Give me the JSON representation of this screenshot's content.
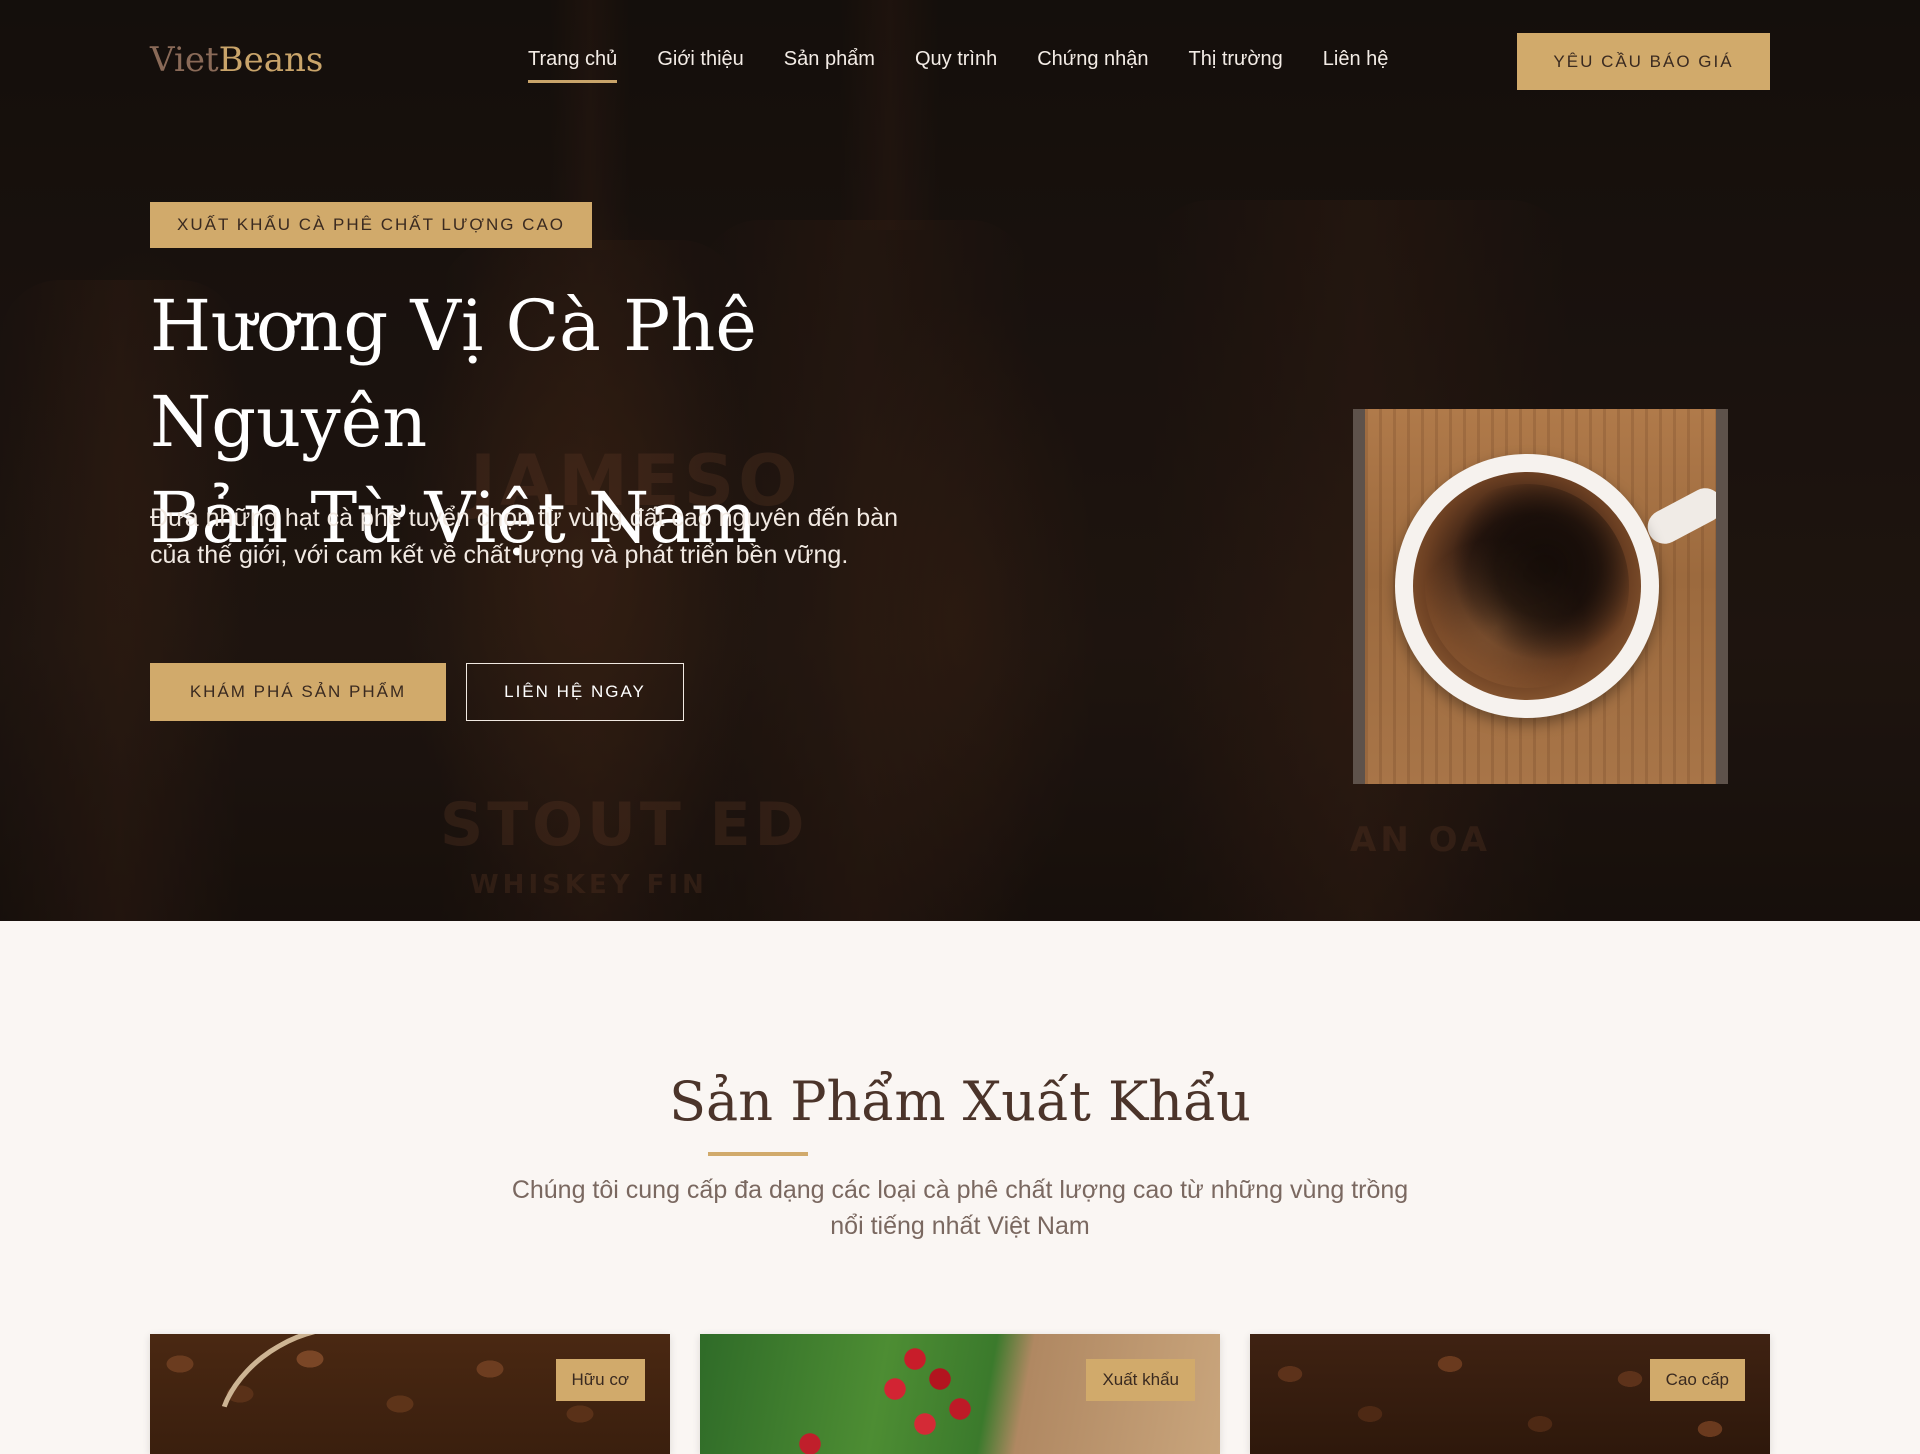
{
  "brand": {
    "part1": "Viet",
    "part2": "Beans"
  },
  "nav": {
    "items": [
      "Trang chủ",
      "Giới thiệu",
      "Sản phẩm",
      "Quy trình",
      "Chứng nhận",
      "Thị trường",
      "Liên hệ"
    ],
    "active_index": 0,
    "cta_label": "YÊU CẦU BÁO GIÁ"
  },
  "hero": {
    "eyebrow": "XUẤT KHẨU CÀ PHÊ CHẤT LƯỢNG CAO",
    "title_line1": "Hương Vị Cà Phê Nguyên",
    "title_line2": "Bản Từ Việt Nam",
    "subtitle": "Đưa những hạt cà phê tuyển chọn từ vùng đất cao nguyên đến bàn của thế giới, với cam kết về chất lượng và phát triển bền vững.",
    "primary_button": "KHÁM PHÁ SẢN PHẨM",
    "secondary_button": "LIÊN HỆ NGAY",
    "background_labels": [
      "JAMESO",
      "STOUT ED",
      "WHISKEY FIN",
      "AN OA"
    ]
  },
  "products": {
    "title": "Sản Phẩm Xuất Khẩu",
    "subtitle": "Chúng tôi cung cấp đa dạng các loại cà phê chất lượng cao từ những vùng trồng nổi tiếng nhất Việt Nam",
    "cards": [
      {
        "badge": "Hữu cơ"
      },
      {
        "badge": "Xuất khẩu"
      },
      {
        "badge": "Cao cấp"
      }
    ]
  },
  "colors": {
    "accent": "#d1aa6b",
    "hero_bg": "#1f1511",
    "page_bg": "#faf6f3",
    "heading": "#4b342a"
  }
}
